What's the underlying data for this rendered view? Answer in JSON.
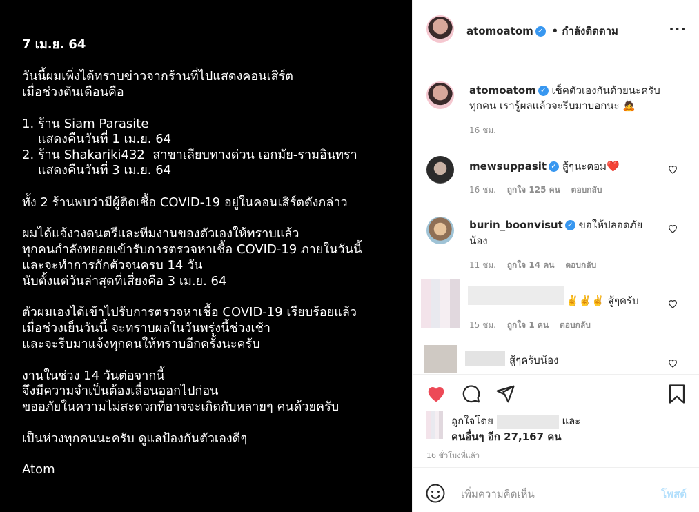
{
  "post_image": {
    "date": "7 เม.ย. 64",
    "lines": [
      "วันนี้ผมเพิ่งได้ทราบข่าวจากร้านที่ไปแสดงคอนเสิร์ต",
      "เมื่อช่วงต้นเดือนคือ",
      "1. ร้าน Siam Parasite",
      "    แสดงคืนวันที่ 1 เม.ย. 64",
      "2. ร้าน Shakariki432  สาขาเลียบทางด่วน เอกมัย-รามอินทรา",
      "    แสดงคืนวันที่ 3 เม.ย. 64",
      "ทั้ง 2 ร้านพบว่ามีผู้ติดเชื้อ COVID-19 อยู่ในคอนเสิร์ตดังกล่าว",
      "ผมได้แจ้งวงดนตรีและทีมงานของตัวเองให้ทราบแล้ว",
      "ทุกคนกำลังทยอยเข้ารับการตรวจหาเชื้อ COVID-19 ภายในวันนี้",
      "และจะทำการกักตัวจนครบ 14 วัน",
      "นับตั้งแต่วันล่าสุดที่เสี่ยงคือ 3 เม.ย. 64",
      "ตัวผมเองได้เข้าไปรับการตรวจหาเชื้อ COVID-19 เรียบร้อยแล้ว",
      "เมื่อช่วงเย็นวันนี้ จะทราบผลในวันพรุ่งนี้ช่วงเช้า",
      "และจะรีบมาแจ้งทุกคนให้ทราบอีกครั้งนะครับ",
      "งานในช่วง 14 วันต่อจากนี้",
      "จึงมีความจำเป็นต้องเลื่อนออกไปก่อน",
      "ขออภัยในความไม่สะดวกที่อาจจะเกิดกับหลายๆ คนด้วยครับ",
      "เป็นห่วงทุกคนนะครับ ดูแลป้องกันตัวเองดีๆ",
      "Atom"
    ]
  },
  "header": {
    "username": "atomoatom",
    "follow_status": "• กำลังติดตาม",
    "more_icon": "more-horizontal-icon"
  },
  "caption": {
    "username": "atomoatom",
    "text_line1": "เช็คตัวเองกันด้วยนะครับ",
    "text_line2": "ทุกคน เรารู้ผลแล้วจะรีบมาบอกนะ 🙇",
    "time": "16 ชม."
  },
  "comments": [
    {
      "username": "mewsuppasit",
      "text": "สู้ๆนะตอม❤️",
      "time": "16 ชม.",
      "likes": "ถูกใจ 125 คน",
      "reply": "ตอบกลับ"
    },
    {
      "username": "burin_boonvisut",
      "text_line1": "ขอให้ปลอดภัย",
      "text_line2": "น้อง",
      "time": "11 ชม.",
      "likes": "ถูกใจ 14 คน",
      "reply": "ตอบกลับ"
    },
    {
      "text": "✌️✌️✌️ สู้ๆครับ",
      "time": "15 ชม.",
      "likes": "ถูกใจ 1 คน",
      "reply": "ตอบกลับ"
    },
    {
      "text": "สู้ๆครับน้อง"
    }
  ],
  "likes": {
    "prefix": "ถูกใจโดย",
    "and": "และ",
    "others": "คนอื่นๆ อีก 27,167 คน",
    "time_ago": "16 ชั่วโมงที่แล้ว"
  },
  "comment_box": {
    "placeholder": "เพิ่มความคิดเห็น",
    "post_label": "โพสต์"
  },
  "colors": {
    "like_red": "#ed4956",
    "verified_blue": "#3897f0",
    "post_btn_disabled": "#b2dffc"
  }
}
